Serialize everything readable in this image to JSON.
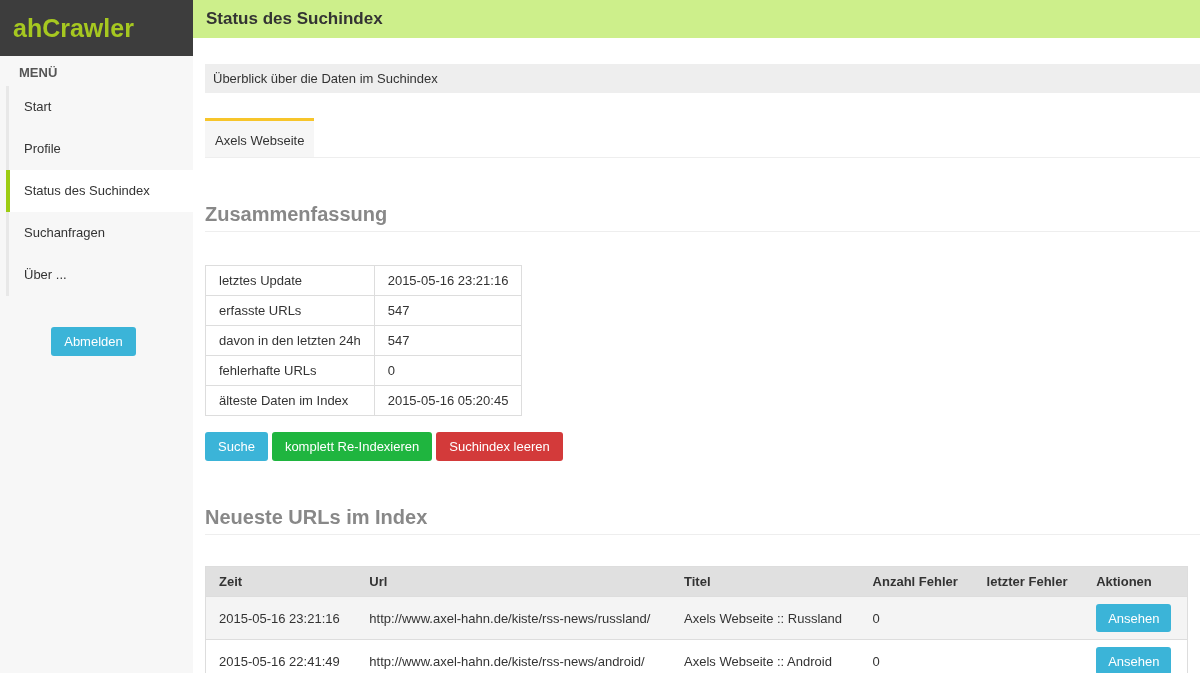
{
  "logo": "ahCrawler",
  "menu": {
    "heading": "MENÜ",
    "items": [
      {
        "label": "Start",
        "selected": false
      },
      {
        "label": "Profile",
        "selected": false
      },
      {
        "label": "Status des Suchindex",
        "selected": true
      },
      {
        "label": "Suchanfragen",
        "selected": false
      },
      {
        "label": "Über ...",
        "selected": false
      }
    ],
    "logout": "Abmelden"
  },
  "page_title": "Status des Suchindex",
  "intro": "Überblick über die Daten im Suchindex",
  "tabs": [
    {
      "label": "Axels Webseite",
      "selected": true
    }
  ],
  "summary": {
    "heading": "Zusammenfassung",
    "rows": [
      {
        "label": "letztes Update",
        "value": "2015-05-16 23:21:16"
      },
      {
        "label": "erfasste URLs",
        "value": "547"
      },
      {
        "label": "davon in den letzten 24h",
        "value": "547"
      },
      {
        "label": "fehlerhafte URLs",
        "value": "0"
      },
      {
        "label": "älteste Daten im Index",
        "value": "2015-05-16 05:20:45"
      }
    ],
    "buttons": [
      {
        "label": "Suche",
        "kind": "info"
      },
      {
        "label": "komplett Re-Indexieren",
        "kind": "success"
      },
      {
        "label": "Suchindex leeren",
        "kind": "danger"
      }
    ]
  },
  "latest": {
    "heading": "Neueste URLs im Index",
    "columns": [
      "Zeit",
      "Url",
      "Titel",
      "Anzahl Fehler",
      "letzter Fehler",
      "Aktionen"
    ],
    "rows": [
      {
        "time": "2015-05-16 23:21:16",
        "url": "http://www.axel-hahn.de/kiste/rss-news/russland/",
        "title": "Axels Webseite :: Russland",
        "errors": "0",
        "action": "Ansehen"
      },
      {
        "time": "2015-05-16 22:41:49",
        "url": "http://www.axel-hahn.de/kiste/rss-news/android/",
        "title": "Axels Webseite :: Android",
        "errors": "0",
        "action": "Ansehen"
      }
    ]
  }
}
